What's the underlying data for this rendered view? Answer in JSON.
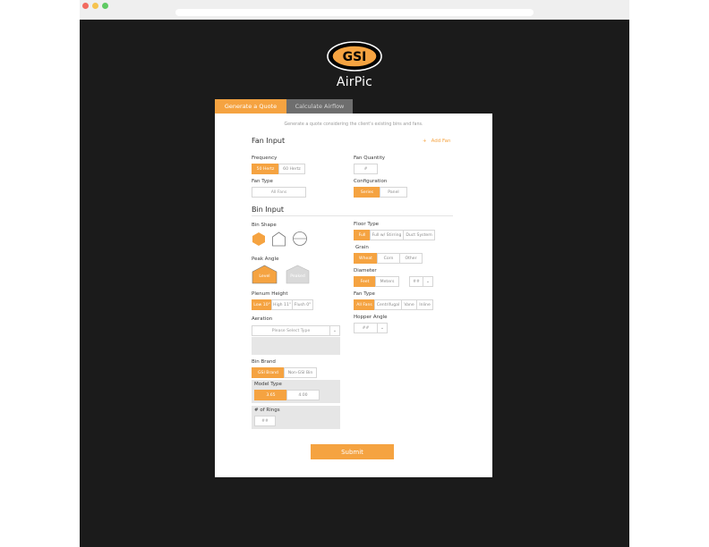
{
  "brand": {
    "logo_text": "GSI",
    "app_name": "AirPic",
    "accent_color": "#f5a341",
    "background_color": "#1b1b1b"
  },
  "tabs": [
    {
      "label": "Generate a Quote",
      "active": true
    },
    {
      "label": "Calculate Airflow",
      "active": false
    }
  ],
  "form": {
    "subtitle": "Generate a quote considering the client's existing bins and fans.",
    "fan_input": {
      "title": "Fan Input",
      "add_fan_label": "Add Fan",
      "frequency": {
        "label": "Frequency",
        "options": [
          "50 Hertz",
          "60 Hertz"
        ],
        "selected": "50 Hertz"
      },
      "fan_quantity": {
        "label": "Fan Quantity",
        "placeholder": "#"
      },
      "fan_type": {
        "label": "Fan Type",
        "value": "All Fans"
      },
      "configuration": {
        "label": "Configuration",
        "options": [
          "Series",
          "Panel"
        ],
        "selected": "Series"
      }
    },
    "bin_input": {
      "title": "Bin Input",
      "bin_shape": {
        "label": "Bin Shape",
        "icons": [
          "hexagon-icon",
          "bin-peaked-icon",
          "bin-round-icon"
        ],
        "selected": "hexagon-icon"
      },
      "peak_angle": {
        "label": "Peak Angle",
        "options": [
          "Level",
          "Peaked"
        ],
        "selected": "Level"
      },
      "plenum_height": {
        "label": "Plenum Height",
        "options": [
          "Low 10\"",
          "High 11\"",
          "Flush 0\""
        ],
        "selected": "Low 10\""
      },
      "aeration": {
        "label": "Aeration",
        "placeholder": "Please Select Type"
      },
      "bin_brand": {
        "label": "Bin Brand",
        "options": [
          "GSI Brand",
          "Non-GSI Bin"
        ],
        "selected": "GSI Brand"
      },
      "model_type": {
        "label": "Model Type",
        "options": [
          "3.65",
          "4.00"
        ],
        "selected": "3.65"
      },
      "num_rings": {
        "label": "# of Rings",
        "placeholder": "##"
      },
      "floor_type": {
        "label": "Floor Type",
        "options": [
          "Full",
          "Full w/ Stirring",
          "Duct System"
        ],
        "selected": "Full"
      },
      "grain": {
        "label": "Grain",
        "options": [
          "Wheat",
          "Corn",
          "Other"
        ],
        "selected": "Wheat"
      },
      "diameter": {
        "label": "Diameter",
        "options": [
          "Feet",
          "Meters"
        ],
        "selected": "Feet",
        "value_placeholder": "##"
      },
      "fan_type": {
        "label": "Fan Type",
        "options": [
          "All Fans",
          "Centrifugal",
          "Vane",
          "Inline"
        ],
        "selected": "All Fans"
      },
      "hopper_angle": {
        "label": "Hopper Angle",
        "placeholder": "##"
      }
    },
    "submit_label": "Submit"
  }
}
